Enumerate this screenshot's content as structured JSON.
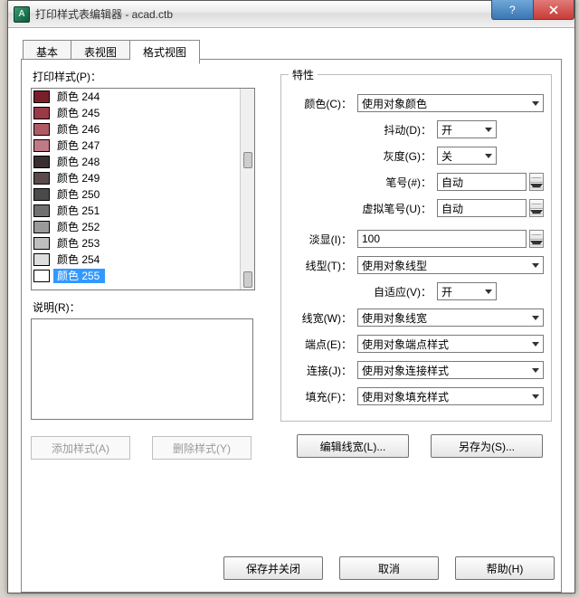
{
  "window": {
    "title": "打印样式表编辑器 - acad.ctb",
    "help_tooltip": "?",
    "close_tooltip": "X"
  },
  "tabs": {
    "basic": "基本",
    "table_view": "表视图",
    "format_view": "格式视图"
  },
  "left": {
    "styles_label": "打印样式(P)：",
    "desc_label": "说明(R)：",
    "add_style_btn": "添加样式(A)",
    "delete_style_btn": "删除样式(Y)",
    "items": [
      {
        "label": "颜色 244",
        "swatch": "#7a1f2a",
        "selected": false
      },
      {
        "label": "颜色 245",
        "swatch": "#9a3a46",
        "selected": false
      },
      {
        "label": "颜色 246",
        "swatch": "#b05a66",
        "selected": false
      },
      {
        "label": "颜色 247",
        "swatch": "#c07a85",
        "selected": false
      },
      {
        "label": "颜色 248",
        "swatch": "#3a2f2f",
        "selected": false
      },
      {
        "label": "颜色 249",
        "swatch": "#5a4a4a",
        "selected": false
      },
      {
        "label": "颜色 250",
        "swatch": "#4a4a4a",
        "selected": false
      },
      {
        "label": "颜色 251",
        "swatch": "#707070",
        "selected": false
      },
      {
        "label": "颜色 252",
        "swatch": "#9a9a9a",
        "selected": false
      },
      {
        "label": "颜色 253",
        "swatch": "#bfbfbf",
        "selected": false
      },
      {
        "label": "颜色 254",
        "swatch": "#dedede",
        "selected": false
      },
      {
        "label": "颜色 255",
        "swatch": "#ffffff",
        "selected": true
      }
    ]
  },
  "props": {
    "legend": "特性",
    "color_label": "颜色(C)：",
    "color_value": "使用对象颜色",
    "dither_label": "抖动(D)：",
    "dither_value": "开",
    "gray_label": "灰度(G)：",
    "gray_value": "关",
    "pen_label": "笔号(#)：",
    "pen_value": "自动",
    "virtpen_label": "虚拟笔号(U)：",
    "virtpen_value": "自动",
    "screen_label": "淡显(I)：",
    "screen_value": "100",
    "linetype_label": "线型(T)：",
    "linetype_value": "使用对象线型",
    "adaptive_label": "自适应(V)：",
    "adaptive_value": "开",
    "lineweight_label": "线宽(W)：",
    "lineweight_value": "使用对象线宽",
    "endstyle_label": "端点(E)：",
    "endstyle_value": "使用对象端点样式",
    "joinstyle_label": "连接(J)：",
    "joinstyle_value": "使用对象连接样式",
    "fillstyle_label": "填充(F)：",
    "fillstyle_value": "使用对象填充样式",
    "edit_lw_btn": "编辑线宽(L)...",
    "saveas_btn": "另存为(S)..."
  },
  "bottom": {
    "save_close": "保存并关闭",
    "cancel": "取消",
    "help": "帮助(H)"
  }
}
